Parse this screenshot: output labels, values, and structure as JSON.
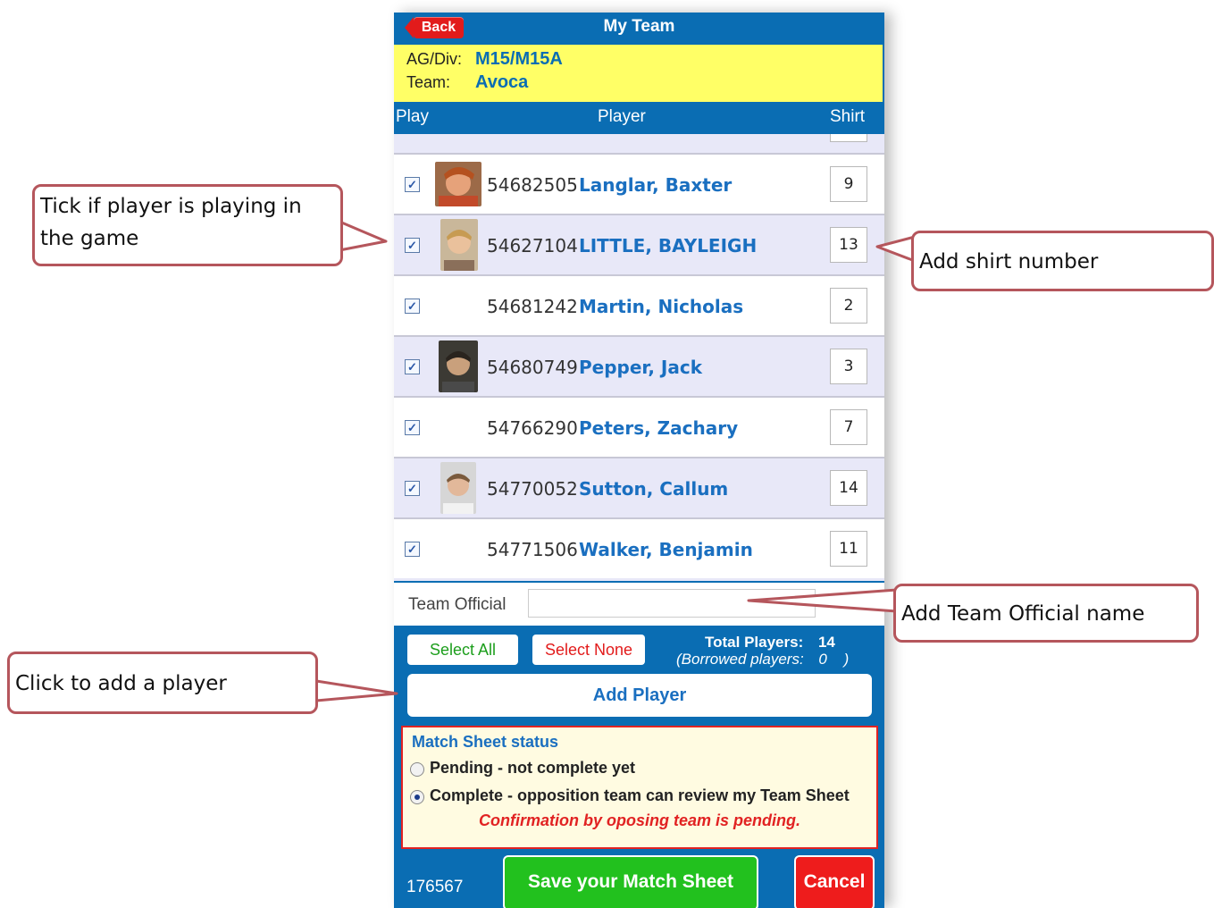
{
  "header": {
    "back_label": "Back",
    "title": "My Team"
  },
  "team_info": {
    "agdiv_label": "AG/Div:",
    "agdiv_value": "M15/M15A",
    "team_label": "Team:",
    "team_value": "Avoca"
  },
  "columns": {
    "play": "Play",
    "player": "Player",
    "shirt": "Shirt"
  },
  "players": [
    {
      "id": "54682505",
      "name": "Langlar, Baxter",
      "shirt": "9",
      "checked": true,
      "photo": true
    },
    {
      "id": "54627104",
      "name": "LITTLE, BAYLEIGH",
      "shirt": "13",
      "checked": true,
      "photo": true
    },
    {
      "id": "54681242",
      "name": "Martin, Nicholas",
      "shirt": "2",
      "checked": true,
      "photo": false
    },
    {
      "id": "54680749",
      "name": "Pepper, Jack",
      "shirt": "3",
      "checked": true,
      "photo": true
    },
    {
      "id": "54766290",
      "name": "Peters, Zachary",
      "shirt": "7",
      "checked": true,
      "photo": false
    },
    {
      "id": "54770052",
      "name": "Sutton, Callum",
      "shirt": "14",
      "checked": true,
      "photo": true
    },
    {
      "id": "54771506",
      "name": "Walker, Benjamin",
      "shirt": "11",
      "checked": true,
      "photo": false
    }
  ],
  "official": {
    "label": "Team Official",
    "value": ""
  },
  "actions": {
    "select_all": "Select All",
    "select_none": "Select None",
    "add_player": "Add Player"
  },
  "totals": {
    "total_label": "Total Players:",
    "total_value": "14",
    "borrowed_label": "(Borrowed players:",
    "borrowed_value": "0",
    "borrowed_close": ")"
  },
  "status": {
    "title": "Match Sheet status",
    "pending_label": "Pending - not complete yet",
    "complete_label": "Complete - opposition team can review my Team Sheet",
    "selected": "complete",
    "confirmation": "Confirmation by oposing team is pending."
  },
  "footer": {
    "id": "176567",
    "save_label": "Save your Match Sheet",
    "cancel_label": "Cancel"
  },
  "callouts": {
    "tick": "Tick if player is playing in the game",
    "shirt": "Add shirt number",
    "official": "Add Team Official name",
    "add": "Click to add a player"
  },
  "colors": {
    "brand_blue": "#0a6db3",
    "header_yellow": "#ffff66",
    "save_green": "#22c11e",
    "cancel_red": "#ee1c1c",
    "name_blue": "#1a6fc0"
  }
}
